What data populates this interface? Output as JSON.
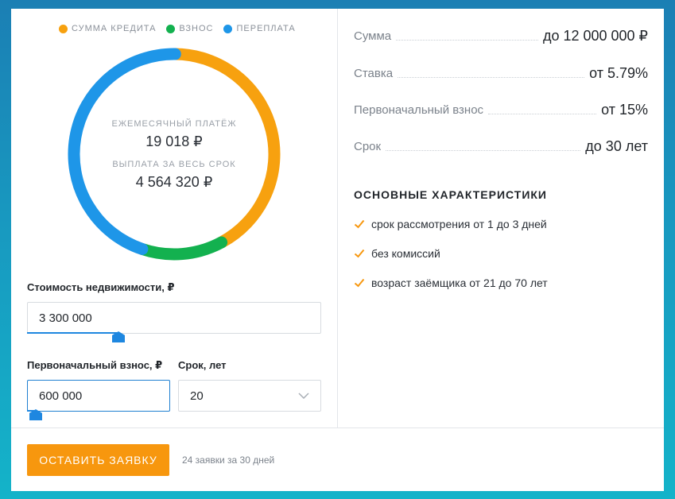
{
  "legend": [
    {
      "label": "СУММА КРЕДИТА",
      "color": "#f7a10f"
    },
    {
      "label": "ВЗНОС",
      "color": "#13b14f"
    },
    {
      "label": "ПЕРЕПЛАТА",
      "color": "#1e96e8"
    }
  ],
  "summary": {
    "monthly_label": "ЕЖЕМЕСЯЧНЫЙ ПЛАТЁЖ",
    "monthly_value": "19 018 ₽",
    "total_label": "ВЫПЛАТА ЗА ВЕСЬ СРОК",
    "total_value": "4 564 320 ₽"
  },
  "chart_data": {
    "type": "pie",
    "categories": [
      "СУММА КРЕДИТА",
      "ВЗНОС",
      "ПЕРЕПЛАТА"
    ],
    "values": [
      0.42,
      0.13,
      0.45
    ],
    "colors": [
      "#f7a10f",
      "#13b14f",
      "#1e96e8"
    ]
  },
  "form": {
    "price_label": "Стоимость недвижимости, ₽",
    "price_value": "3 300 000",
    "price_slider_fraction": 0.31,
    "down_label": "Первоначальный взнос, ₽",
    "down_value": "600 000",
    "down_slider_fraction": 0.06,
    "term_label": "Срок, лет",
    "term_value": "20"
  },
  "conditions": [
    {
      "label": "Сумма",
      "value": "до 12 000 000 ₽"
    },
    {
      "label": "Ставка",
      "value": "от 5.79%"
    },
    {
      "label": "Первоначальный взнос",
      "value": "от 15%"
    },
    {
      "label": "Срок",
      "value": "до 30 лет"
    }
  ],
  "features_title": "ОСНОВНЫЕ ХАРАКТЕРИСТИКИ",
  "features": [
    "срок рассмотрения от 1 до 3 дней",
    "без комиссий",
    "возраст заёмщика от 21 до 70 лет"
  ],
  "footer": {
    "button_label": "ОСТАВИТЬ ЗАЯВКУ",
    "note": "24 заявки за 30 дней"
  },
  "colors": {
    "accent": "#f7970e",
    "blue": "#1e87e0",
    "check": "#f7970e"
  }
}
